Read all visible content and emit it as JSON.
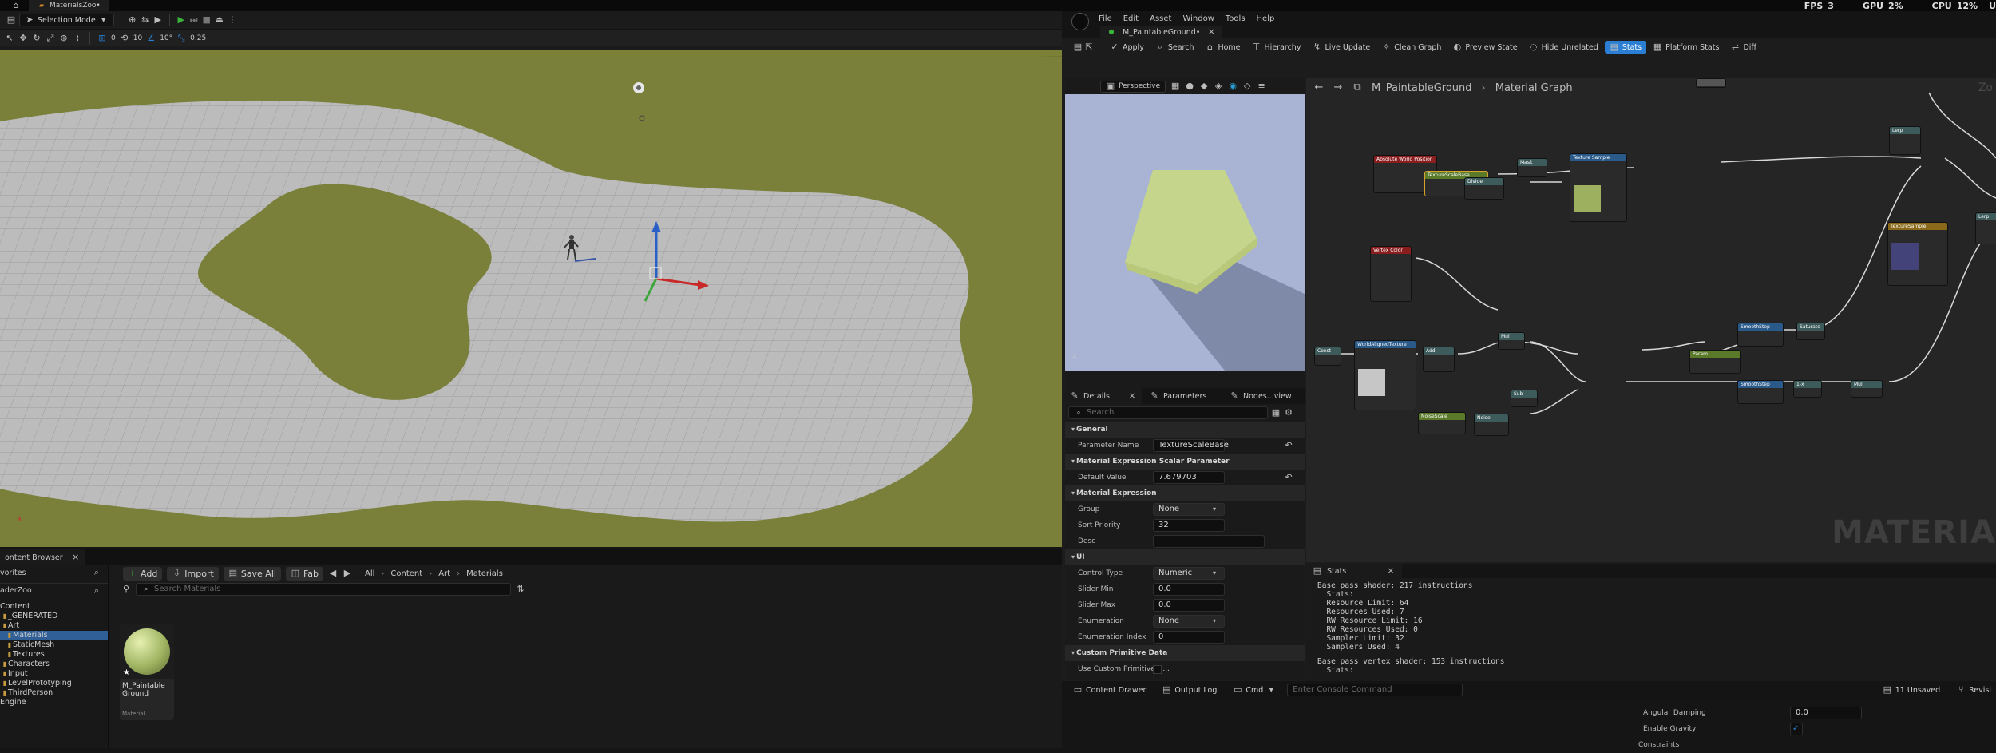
{
  "topbar": {
    "project_tab": "MaterialsZoo•",
    "fps_label": "FPS",
    "fps_value": "3",
    "gpu_label": "GPU",
    "gpu_value": "2%",
    "cpu_label": "CPU",
    "cpu_value": "12%",
    "trailing": "U"
  },
  "viewport_toolbar": {
    "mode": "Selection Mode",
    "snap_grid": "10",
    "snap_rot": "10°",
    "snap_scale": "0.25",
    "zoom": "0"
  },
  "viewport": {
    "axis_label": "x"
  },
  "content_browser": {
    "tab": "ontent Browser",
    "favorites": "vorites",
    "project": "aderZoo",
    "add": "Add",
    "import": "Import",
    "save_all": "Save All",
    "fab": "Fab",
    "breadcrumb": [
      "All",
      "Content",
      "Art",
      "Materials"
    ],
    "search_placeholder": "Search Materials",
    "tree": [
      {
        "label": "Content",
        "indent": 0
      },
      {
        "label": "_GENERATED",
        "indent": 1
      },
      {
        "label": "Art",
        "indent": 1
      },
      {
        "label": "Materials",
        "indent": 2,
        "selected": true
      },
      {
        "label": "StaticMesh",
        "indent": 2
      },
      {
        "label": "Textures",
        "indent": 2
      },
      {
        "label": "Characters",
        "indent": 1
      },
      {
        "label": "Input",
        "indent": 1
      },
      {
        "label": "LevelPrototyping",
        "indent": 1
      },
      {
        "label": "ThirdPerson",
        "indent": 1
      },
      {
        "label": "Engine",
        "indent": 0
      }
    ],
    "asset": {
      "name_line1": "M_Paintable",
      "name_line2": "Ground",
      "type": "Material"
    }
  },
  "material_editor": {
    "menu": [
      "File",
      "Edit",
      "Asset",
      "Window",
      "Tools",
      "Help"
    ],
    "tab": "M_PaintableGround•",
    "toolbar": [
      {
        "label": "Apply",
        "icon": "apply-icon"
      },
      {
        "label": "Search",
        "icon": "search-icon"
      },
      {
        "label": "Home",
        "icon": "home-icon"
      },
      {
        "label": "Hierarchy",
        "icon": "hierarchy-icon"
      },
      {
        "label": "Live Update",
        "icon": "live-update-icon"
      },
      {
        "label": "Clean Graph",
        "icon": "clean-graph-icon"
      },
      {
        "label": "Preview State",
        "icon": "preview-state-icon"
      },
      {
        "label": "Hide Unrelated",
        "icon": "hide-unrelated-icon"
      },
      {
        "label": "Stats",
        "icon": "stats-icon",
        "active": true
      },
      {
        "label": "Platform Stats",
        "icon": "platform-stats-icon"
      },
      {
        "label": "Diff",
        "icon": "diff-icon"
      }
    ],
    "preview": {
      "mode": "Perspective"
    },
    "breadcrumb": {
      "asset": "M_PaintableGround",
      "graph": "Material Graph"
    },
    "watermark": "MATERIA",
    "zoom_hint": "Zo",
    "details": {
      "tabs": [
        "Details",
        "Parameters",
        "Nodes...view"
      ],
      "search_placeholder": "Search",
      "sections": [
        {
          "title": "General",
          "rows": [
            {
              "name": "Parameter Name",
              "value": "TextureScaleBase"
            }
          ]
        },
        {
          "title": "Material Expression Scalar Parameter",
          "rows": [
            {
              "name": "Default Value",
              "value": "7.679703"
            }
          ]
        },
        {
          "title": "Material Expression",
          "rows": [
            {
              "name": "Group",
              "value": "None"
            },
            {
              "name": "Sort Priority",
              "value": "32"
            },
            {
              "name": "Desc",
              "value": ""
            }
          ]
        },
        {
          "title": "UI",
          "rows": [
            {
              "name": "Control Type",
              "value": "Numeric"
            },
            {
              "name": "Slider Min",
              "value": "0.0"
            },
            {
              "name": "Slider Max",
              "value": "0.0"
            },
            {
              "name": "Enumeration",
              "value": "None"
            },
            {
              "name": "Enumeration Index",
              "value": "0"
            }
          ]
        },
        {
          "title": "Custom Primitive Data",
          "rows": [
            {
              "name": "Use Custom Primitive D...",
              "value": ""
            }
          ]
        }
      ]
    },
    "stats": {
      "tab": "Stats",
      "lines": [
        "Base pass shader: 217 instructions",
        "  Stats:",
        "  Resource Limit: 64",
        "  Resources Used: 7",
        "  RW Resource Limit: 16",
        "  RW Resources Used: 0",
        "  Sampler Limit: 32",
        "  Samplers Used: 4",
        "",
        "Base pass vertex shader: 153 instructions",
        "  Stats:"
      ]
    },
    "bottom": {
      "content_drawer": "Content Drawer",
      "output_log": "Output Log",
      "cmd": "Cmd",
      "console_placeholder": "Enter Console Command",
      "unsaved": "11 Unsaved",
      "revision": "Revisi"
    },
    "physics": [
      {
        "name": "Angular Damping",
        "value": "0.0"
      },
      {
        "name": "Enable Gravity",
        "value": "✓"
      },
      {
        "name": "Constraints",
        "value": ""
      }
    ]
  },
  "colors": {
    "accent": "#2a7fd4",
    "ground": "#7a7f3a",
    "tiles": "#b9b9b9",
    "preview_bg": "#a9b3d3",
    "cube": "#c5d68c"
  }
}
